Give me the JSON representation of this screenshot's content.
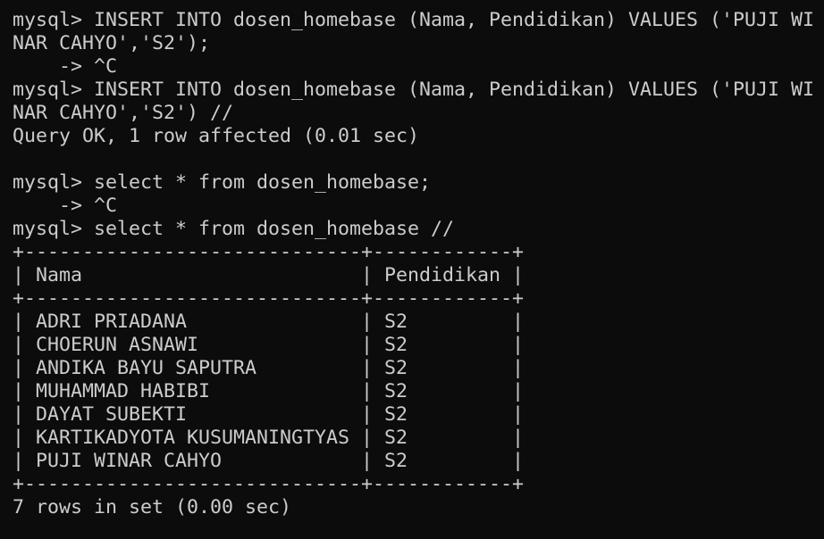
{
  "terminal": {
    "foreground": "#cccccc",
    "background": "#0c0c0c",
    "lines": [
      "mysql> INSERT INTO dosen_homebase (Nama, Pendidikan) VALUES ('PUJI WI",
      "NAR CAHYO','S2');",
      "    -> ^C",
      "mysql> INSERT INTO dosen_homebase (Nama, Pendidikan) VALUES ('PUJI WI",
      "NAR CAHYO','S2') //",
      "Query OK, 1 row affected (0.01 sec)",
      "",
      "mysql> select * from dosen_homebase;",
      "    -> ^C",
      "mysql> select * from dosen_homebase //",
      "+-----------------------------+------------+",
      "| Nama                        | Pendidikan |",
      "+-----------------------------+------------+",
      "| ADRI PRIADANA               | S2         |",
      "| CHOERUN ASNAWI              | S2         |",
      "| ANDIKA BAYU SAPUTRA         | S2         |",
      "| MUHAMMAD HABIBI             | S2         |",
      "| DAYAT SUBEKTI               | S2         |",
      "| KARTIKADYOTA KUSUMANINGTYAS | S2         |",
      "| PUJI WINAR CAHYO            | S2         |",
      "+-----------------------------+------------+",
      "7 rows in set (0.00 sec)"
    ]
  }
}
